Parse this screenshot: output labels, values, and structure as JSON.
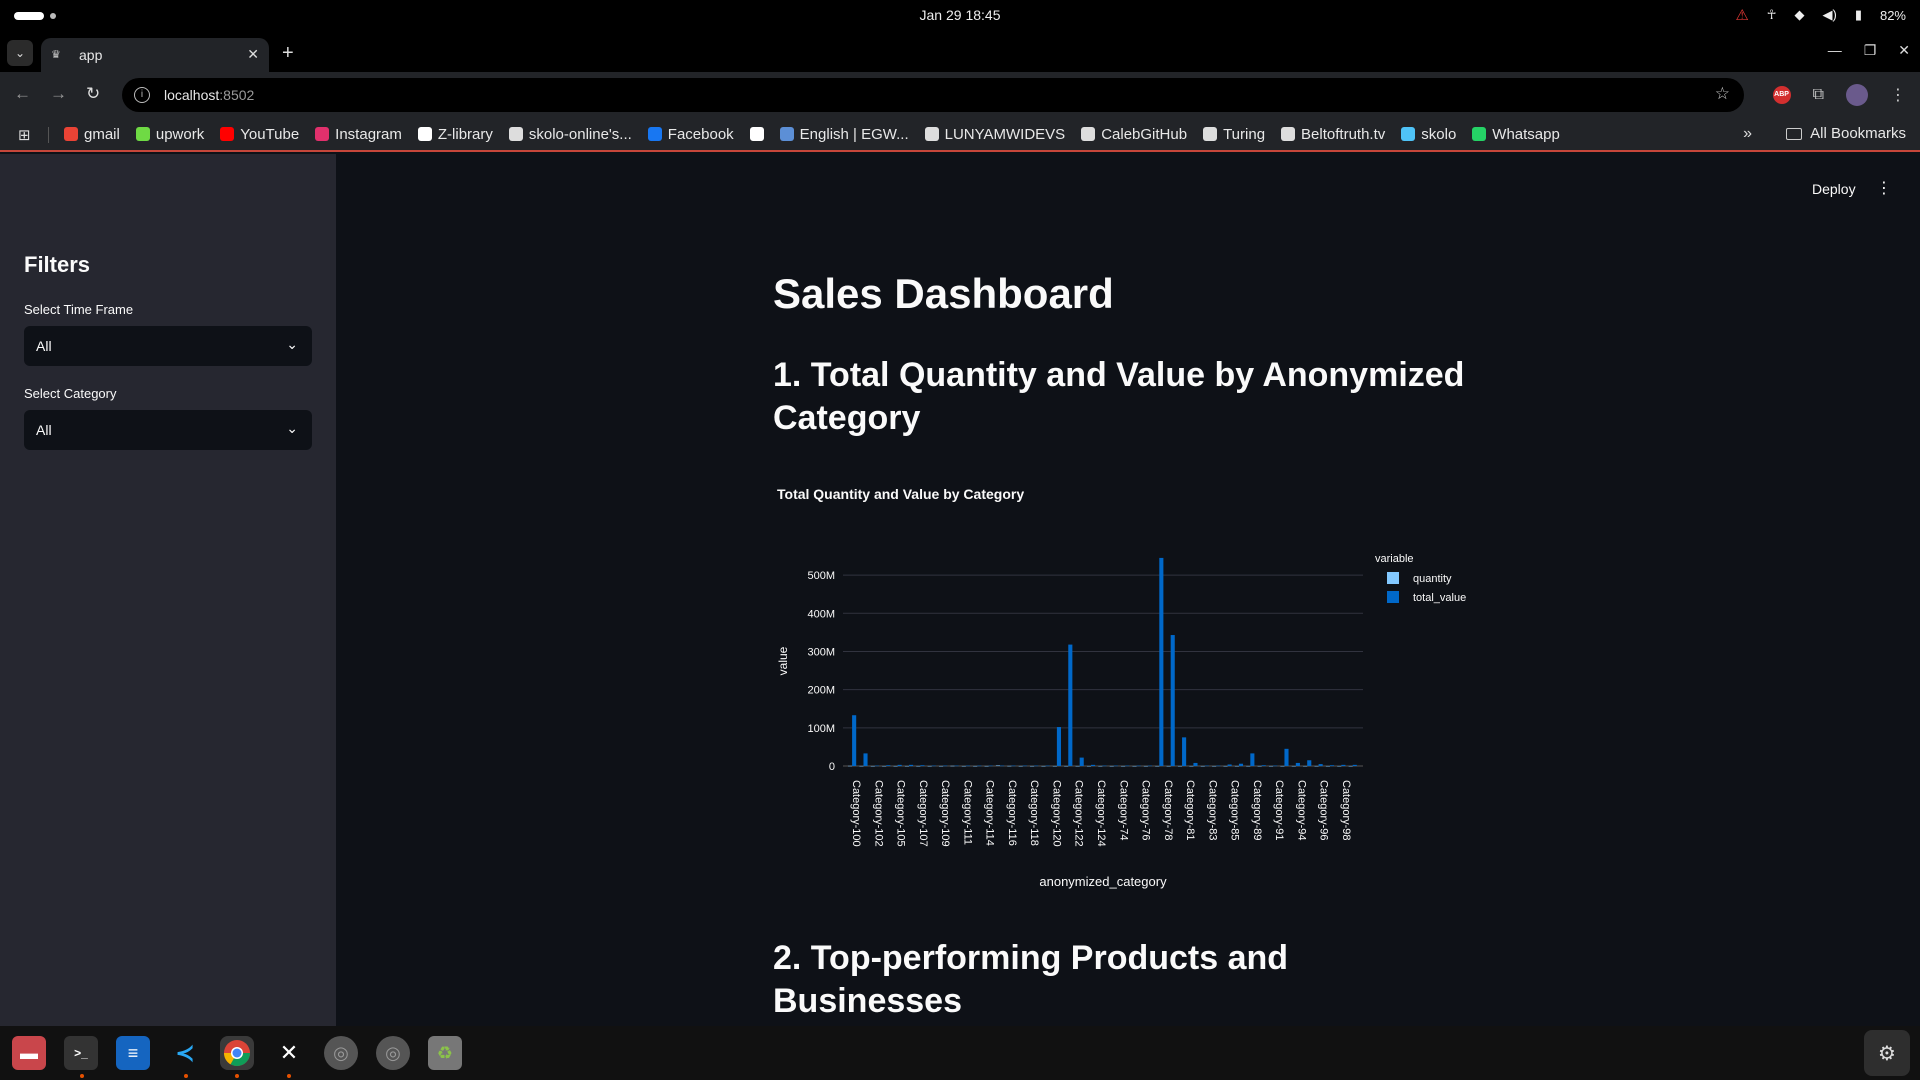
{
  "os": {
    "clock": "Jan 29  18:45",
    "battery": "82%",
    "icons": [
      "warning-icon",
      "accessibility-icon",
      "wifi-icon",
      "volume-icon",
      "battery-icon"
    ]
  },
  "browser": {
    "tab_title": "app",
    "url_host": "localhost",
    "url_port": ":8502",
    "bookmarks": [
      {
        "label": "gmail",
        "icon": "gmail-icon",
        "color": "#ea4335"
      },
      {
        "label": "upwork",
        "icon": "upwork-icon",
        "color": "#6fda44"
      },
      {
        "label": "YouTube",
        "icon": "youtube-icon",
        "color": "#ff0000"
      },
      {
        "label": "Instagram",
        "icon": "instagram-icon",
        "color": "#e1306c"
      },
      {
        "label": "Z-library",
        "icon": "zlibrary-icon",
        "color": "#ffffff"
      },
      {
        "label": "skolo-online's...",
        "icon": "github-icon",
        "color": "#dddddd"
      },
      {
        "label": "Facebook",
        "icon": "facebook-icon",
        "color": "#1877f2"
      },
      {
        "label": "",
        "icon": "google-icon",
        "color": "#ffffff"
      },
      {
        "label": "English | EGW...",
        "icon": "egw-icon",
        "color": "#5c8fd6"
      },
      {
        "label": "LUNYAMWIDEVS",
        "icon": "github-icon",
        "color": "#dddddd"
      },
      {
        "label": "CalebGitHub",
        "icon": "github-icon",
        "color": "#dddddd"
      },
      {
        "label": "Turing",
        "icon": "turing-icon",
        "color": "#dddddd"
      },
      {
        "label": "Beltoftruth.tv",
        "icon": "globe-icon",
        "color": "#dddddd"
      },
      {
        "label": "skolo",
        "icon": "skolo-icon",
        "color": "#4fc3f7"
      },
      {
        "label": "Whatsapp",
        "icon": "whatsapp-icon",
        "color": "#25d366"
      }
    ],
    "all_bookmarks": "All Bookmarks"
  },
  "app": {
    "deploy_label": "Deploy",
    "title": "Sales Dashboard",
    "section1": "1. Total Quantity and Value by Anonymized Category",
    "section2": "2. Top-performing Products and Businesses"
  },
  "sidebar": {
    "title": "Filters",
    "time_frame_label": "Select Time Frame",
    "time_frame_value": "All",
    "category_label": "Select Category",
    "category_value": "All"
  },
  "chart_data": {
    "type": "bar",
    "title": "Total Quantity and Value by Category",
    "xlabel": "anonymized_category",
    "ylabel": "value",
    "legend_title": "variable",
    "legend_position": "top-right",
    "ylim": [
      0,
      550000000
    ],
    "yticks": [
      0,
      100000000,
      200000000,
      300000000,
      400000000,
      500000000
    ],
    "ytick_labels": [
      "0",
      "100M",
      "200M",
      "300M",
      "400M",
      "500M"
    ],
    "tick_categories": [
      "Category-100",
      "Category-102",
      "Category-105",
      "Category-107",
      "Category-109",
      "Category-111",
      "Category-114",
      "Category-116",
      "Category-118",
      "Category-120",
      "Category-122",
      "Category-124",
      "Category-74",
      "Category-76",
      "Category-78",
      "Category-81",
      "Category-83",
      "Category-85",
      "Category-89",
      "Category-91",
      "Category-94",
      "Category-96",
      "Category-98"
    ],
    "grid": true,
    "series": [
      {
        "name": "quantity",
        "color": "#83c9ff",
        "values": [
          0.5,
          0.2,
          0.1,
          0.1,
          0.1,
          0.1,
          0.1,
          0.1,
          0.1,
          0.5,
          0.1,
          0.1,
          0.1,
          1.5,
          0.3,
          0.1,
          0.1,
          0.1,
          0.1,
          0.1,
          0.1,
          0.1,
          0.1,
          0.1,
          0.1,
          0.1,
          0.1,
          0.1,
          0.1,
          0.1,
          0.1,
          0.1,
          0.1,
          0.1,
          0.1,
          0.1,
          0.1,
          0.1,
          0.1,
          0.1,
          0.1,
          0.1,
          0.1,
          0.1,
          0.1
        ]
      },
      {
        "name": "total_value",
        "color": "#0068c9",
        "values": [
          133,
          33,
          1,
          2,
          3,
          3,
          2,
          1,
          1,
          1,
          1,
          1,
          1,
          1,
          1,
          1,
          1,
          1,
          102,
          318,
          22,
          3,
          1,
          1,
          1,
          1,
          1,
          545,
          343,
          75,
          8,
          1,
          1,
          4,
          6,
          33,
          2,
          1,
          45,
          8,
          15,
          5,
          2,
          3,
          3
        ]
      }
    ],
    "value_unit": "millions"
  }
}
